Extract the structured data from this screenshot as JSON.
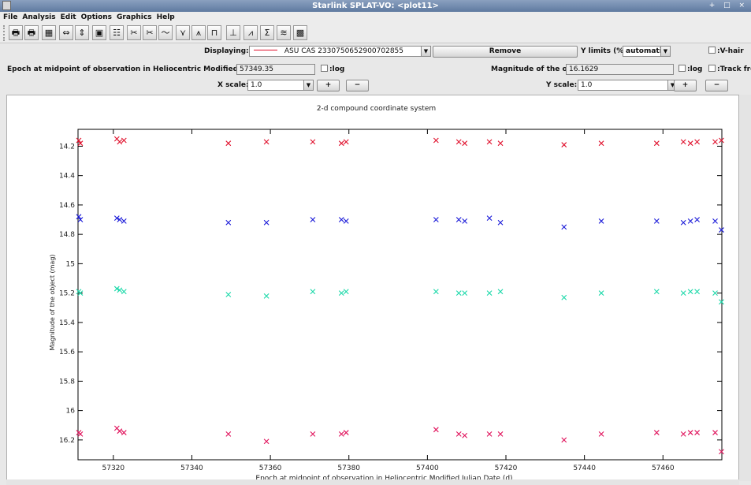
{
  "window": {
    "title": "Starlink SPLAT-VO: <plot11>",
    "controls": "+ □ ×"
  },
  "menu": [
    "File",
    "Analysis",
    "Edit",
    "Options",
    "Graphics",
    "Help"
  ],
  "toolbar": [
    {
      "icon": "print-icon",
      "glyph": "🖶"
    },
    {
      "icon": "print-postscript-icon",
      "glyph": "🖶"
    },
    {
      "icon": "jpeg-export-icon",
      "glyph": "▦"
    },
    {
      "icon": "fit-width-icon",
      "glyph": "⇔"
    },
    {
      "icon": "fit-height-icon",
      "glyph": "⇕"
    },
    {
      "icon": "zoom-box-icon",
      "glyph": "▣"
    },
    {
      "icon": "properties-icon",
      "glyph": "☷"
    },
    {
      "icon": "cut-icon",
      "glyph": "✂"
    },
    {
      "icon": "cut-ranges-icon",
      "glyph": "✂"
    },
    {
      "icon": "smooth-icon",
      "glyph": "〜"
    },
    {
      "icon": "fit-lines-icon",
      "glyph": "⋎"
    },
    {
      "icon": "polynomial-icon",
      "glyph": "⩚"
    },
    {
      "icon": "filter-icon",
      "glyph": "⊓"
    },
    {
      "icon": "units-icon",
      "glyph": "⊥"
    },
    {
      "icon": "flux-icon",
      "glyph": "⩘"
    },
    {
      "icon": "sum-icon",
      "glyph": "Σ"
    },
    {
      "icon": "stack-icon",
      "glyph": "≋"
    },
    {
      "icon": "image-icon",
      "glyph": "▩"
    }
  ],
  "displaying": {
    "label": "Displaying:",
    "value": "ASU CAS 2330750652900702855",
    "remove": "Remove"
  },
  "ylimits": {
    "label": "Y limits (%):",
    "value": "automatic"
  },
  "vhair": "V-hair",
  "xcoord": {
    "label": "Epoch at midpoint of observation in Heliocentric Modified Julian Date:",
    "value": "57349.35",
    "log": "log"
  },
  "ycoord": {
    "label": "Magnitude of the object:",
    "value": "16.1629",
    "log": "log",
    "track": "Track free"
  },
  "xscale": {
    "label": "X scale:",
    "value": "1.0",
    "plus": "+",
    "minus": "−"
  },
  "yscale": {
    "label": "Y scale:",
    "value": "1.0",
    "plus": "+",
    "minus": "−"
  },
  "chart_data": {
    "type": "scatter",
    "title": "2-d compound coordinate system",
    "xlabel": "Epoch at midpoint of observation in Heliocentric Modified Julian Date (d)",
    "ylabel": "Magnitude of the object (mag)",
    "xlim": [
      57311,
      57475
    ],
    "ylim": [
      16.335,
      14.085
    ],
    "y_inverted": true,
    "xticks": [
      57320,
      57340,
      57360,
      57380,
      57400,
      57420,
      57440,
      57460
    ],
    "yticks": [
      14.2,
      14.4,
      14.6,
      14.8,
      15,
      15.2,
      15.4,
      15.6,
      15.8,
      16,
      16.2
    ],
    "ytick_labels": [
      "14.2",
      "14.4",
      "14.6",
      "14.8",
      "15",
      "15.2",
      "15.4",
      "15.6",
      "15.8",
      "16",
      "16.2"
    ],
    "marker": "x",
    "epochs": [
      57311.2,
      57311.6,
      57320.9,
      57321.6,
      57322.7,
      57349.3,
      57359.0,
      57370.8,
      57378.1,
      57379.3,
      57402.2,
      57408.0,
      57409.5,
      57415.8,
      57418.6,
      57434.8,
      57444.3,
      57458.4,
      57465.2,
      57467.0,
      57468.7,
      57473.3,
      57474.9
    ],
    "series": [
      {
        "name": "",
        "color": "#e0102c",
        "values": [
          14.16,
          14.18,
          14.15,
          14.17,
          14.16,
          14.18,
          14.17,
          14.17,
          14.18,
          14.17,
          14.16,
          14.17,
          14.18,
          14.17,
          14.18,
          14.19,
          14.18,
          14.18,
          14.17,
          14.18,
          14.17,
          14.17,
          14.16
        ]
      },
      {
        "name": "",
        "color": "#1818d8",
        "values": [
          14.68,
          14.7,
          14.69,
          14.7,
          14.71,
          14.72,
          14.72,
          14.7,
          14.7,
          14.71,
          14.7,
          14.7,
          14.71,
          14.69,
          14.72,
          14.75,
          14.71,
          14.71,
          14.72,
          14.71,
          14.7,
          14.71,
          14.77
        ]
      },
      {
        "name": "",
        "color": "#18d8a8",
        "values": [
          15.19,
          15.2,
          15.17,
          15.18,
          15.19,
          15.21,
          15.22,
          15.19,
          15.2,
          15.19,
          15.19,
          15.2,
          15.2,
          15.2,
          15.19,
          15.23,
          15.2,
          15.19,
          15.2,
          15.19,
          15.19,
          15.2,
          15.26
        ]
      },
      {
        "name": "",
        "color": "#e0105a",
        "values": [
          16.15,
          16.16,
          16.12,
          16.14,
          16.15,
          16.16,
          16.21,
          16.16,
          16.16,
          16.15,
          16.13,
          16.16,
          16.17,
          16.16,
          16.16,
          16.2,
          16.16,
          16.15,
          16.16,
          16.15,
          16.15,
          16.15,
          16.28
        ]
      }
    ]
  }
}
